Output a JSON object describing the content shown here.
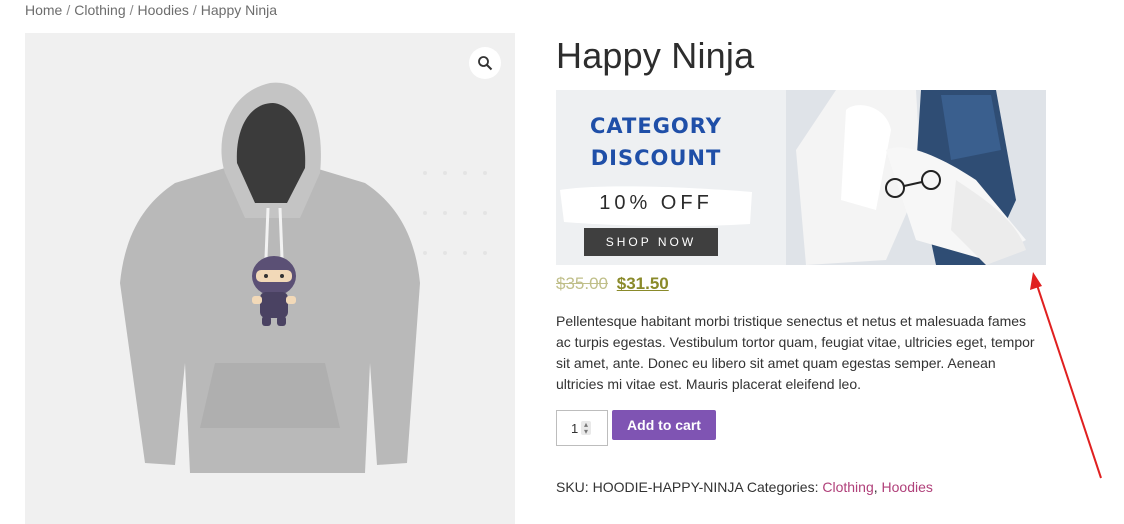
{
  "breadcrumb": {
    "items": [
      "Home",
      "Clothing",
      "Hoodies",
      "Happy Ninja"
    ],
    "separator": "/"
  },
  "product": {
    "title": "Happy Ninja",
    "price_old": "$35.00",
    "price_new": "$31.50",
    "description": "Pellentesque habitant morbi tristique senectus et netus et malesuada fames ac turpis egestas. Vestibulum tortor quam, feugiat vitae, ultricies eget, tempor sit amet, ante. Donec eu libero sit amet quam egestas semper. Aenean ultricies mi vitae est. Mauris placerat eleifend leo.",
    "quantity": "1",
    "add_to_cart_label": "Add to cart",
    "sku_label": "SKU:",
    "sku": "HOODIE-HAPPY-NINJA",
    "categories_label": "Categories:",
    "categories": [
      "Clothing",
      "Hoodies"
    ],
    "category_separator": ","
  },
  "banner": {
    "line1": "CATEGORY",
    "line2": "DISCOUNT",
    "offer": "10% OFF",
    "cta": "SHOP NOW"
  },
  "icons": {
    "zoom": "magnifier-icon",
    "annotation": "red-arrow"
  },
  "colors": {
    "accent_button": "#7f54b3",
    "link": "#b0407a",
    "price_new": "#8a8a2a",
    "banner_heading": "#1f4fa8",
    "annotation_arrow": "#e02020"
  }
}
